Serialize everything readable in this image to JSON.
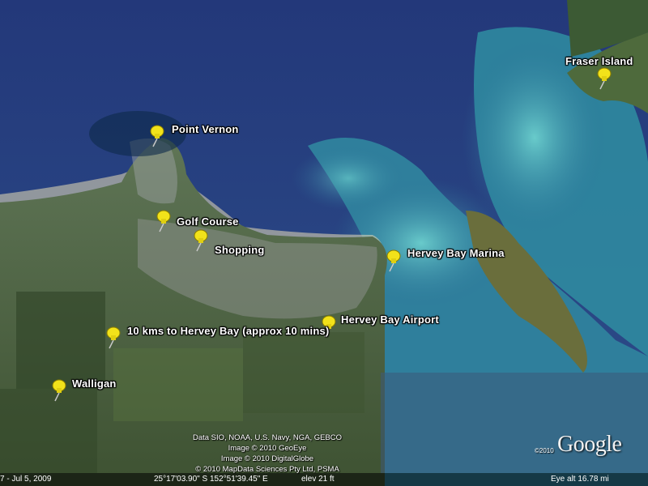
{
  "placemarks": [
    {
      "label": "Point Vernon"
    },
    {
      "label": "Golf Course"
    },
    {
      "label": "Shopping"
    },
    {
      "label": "Hervey Bay Marina"
    },
    {
      "label": "Hervey Bay Airport"
    },
    {
      "label": "10 kms to Hervey Bay (approx 10 mins)"
    },
    {
      "label": "Walligan"
    },
    {
      "label": "Fraser Island"
    }
  ],
  "attribution": {
    "line1": "Data SIO, NOAA, U.S. Navy, NGA, GEBCO",
    "line2": "Image © 2010 GeoEye",
    "line3": "Image © 2010 DigitalGlobe",
    "line4": "© 2010 MapData Sciences Pty Ltd, PSMA"
  },
  "logo": {
    "year": "©2010",
    "text": "Google"
  },
  "status_bar": {
    "timeline": "7 - Jul 5, 2009",
    "coordinates": "25°17'03.90\" S    152°51'39.45\" E",
    "elevation": "elev    21 ft",
    "eye_alt": "Eye alt    16.78 mi"
  },
  "colors": {
    "deep_water": "#1f3a7a",
    "shallow_water": "#3aa6b0",
    "land": "#4a6a3a",
    "pin": "#f2e21a"
  }
}
